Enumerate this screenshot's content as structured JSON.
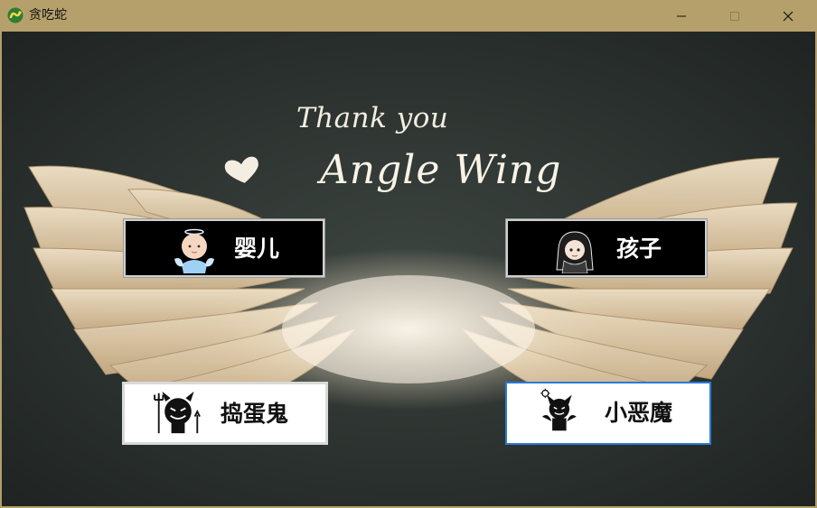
{
  "window": {
    "title": "贪吃蛇",
    "icon": "snake-app-icon",
    "controls": {
      "minimize_icon": "minimize-icon",
      "maximize_icon": "maximize-icon",
      "close_icon": "close-icon"
    }
  },
  "background": {
    "line1": "Thank you",
    "line2": "Angle Wing"
  },
  "choices": [
    {
      "label": "婴儿",
      "icon": "baby-angel-icon",
      "style": "dark"
    },
    {
      "label": "孩子",
      "icon": "anime-child-icon",
      "style": "dark"
    },
    {
      "label": "捣蛋鬼",
      "icon": "devil-trident-icon",
      "style": "light"
    },
    {
      "label": "小恶魔",
      "icon": "little-demon-icon",
      "style": "light",
      "focused": true
    }
  ],
  "colors": {
    "titlebar": "#b5a06c",
    "chalkboard": "#2f3532",
    "focus_border": "#2a7ad5"
  }
}
